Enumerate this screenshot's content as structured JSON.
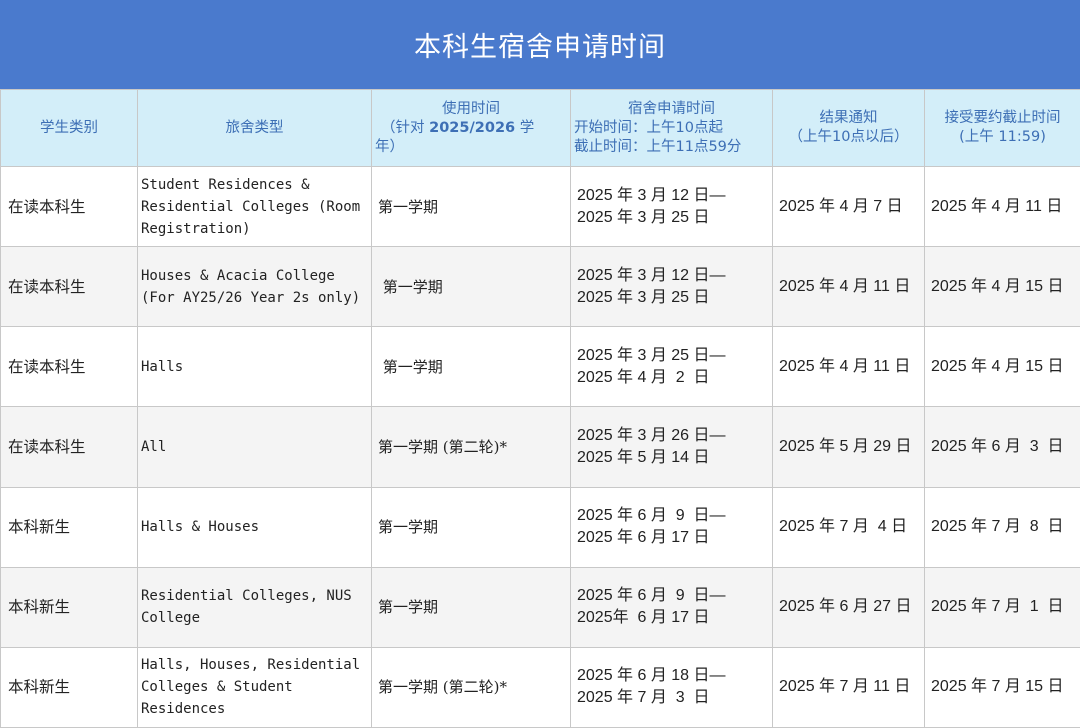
{
  "title": "本科生宿舍申请时间",
  "headers": {
    "student_type": "学生类别",
    "hostel_type": "旅舍类型",
    "usage_l1": "使用时间",
    "usage_l2_pre": "（针对 ",
    "usage_l2_bold": "2025/2026",
    "usage_l2_post": " 学",
    "usage_l3": "年）",
    "apply_l1": "宿舍申请时间",
    "apply_l2": "开始时间：上午10点起",
    "apply_l3": "截止时间：上午11点59分",
    "result_l1": "结果通知",
    "result_l2": "（上午10点以后）",
    "accept_l1": "接受要约截止时间",
    "accept_l2": "(上午 11:59)"
  },
  "rows": [
    {
      "student_type": "在读本科生",
      "hostel_type": "Student Residences & Residential Colleges (Room Registration)",
      "period": "第一学期",
      "apply_start": "2025 年 3 月 12 日—",
      "apply_end": "2025 年 3 月 25 日",
      "result": "2025 年 4 月 7  日",
      "accept": "2025 年 4 月 11 日"
    },
    {
      "student_type": "在读本科生",
      "hostel_type": "Houses & Acacia College (For AY25/26 Year 2s only)",
      "period": " 第一学期",
      "apply_start": "2025 年 3 月 12 日—",
      "apply_end": "2025 年 3 月 25 日",
      "result": "2025 年 4 月 11 日",
      "accept": "2025 年 4 月 15 日"
    },
    {
      "student_type": "在读本科生",
      "hostel_type": "Halls",
      "period": " 第一学期",
      "apply_start": "2025 年 3 月 25 日—",
      "apply_end": "2025 年 4 月  2  日",
      "result": "2025 年 4 月 11 日",
      "accept": "2025 年 4 月 15 日"
    },
    {
      "student_type": "在读本科生",
      "hostel_type": "All",
      "period": "第一学期 (第二轮)*",
      "apply_start": "2025 年 3 月 26 日—",
      "apply_end": "2025 年 5 月 14 日",
      "result": "2025 年 5 月 29 日",
      "accept": "2025 年 6 月  3  日"
    },
    {
      "student_type": "本科新生",
      "hostel_type": "Halls & Houses",
      "period": "第一学期",
      "apply_start": "2025 年 6 月  9  日—",
      "apply_end": "2025 年 6 月 17 日",
      "result": "2025 年 7 月  4 日",
      "accept": "2025 年 7 月  8  日"
    },
    {
      "student_type": "本科新生",
      "hostel_type": "Residential Colleges, NUS College",
      "period": "第一学期",
      "apply_start": "2025 年 6 月  9  日—",
      "apply_end": "2025年  6 月 17 日",
      "result": "2025 年 6 月 27 日",
      "accept": "2025 年 7 月  1  日"
    },
    {
      "student_type": "本科新生",
      "hostel_type": "Halls, Houses, Residential Colleges & Student Residences",
      "period": "第一学期 (第二轮)*",
      "apply_start": "2025 年 6 月 18 日—",
      "apply_end": "2025 年 7 月  3  日",
      "result": "2025 年 7 月 11 日",
      "accept": "2025 年 7 月 15 日"
    }
  ]
}
